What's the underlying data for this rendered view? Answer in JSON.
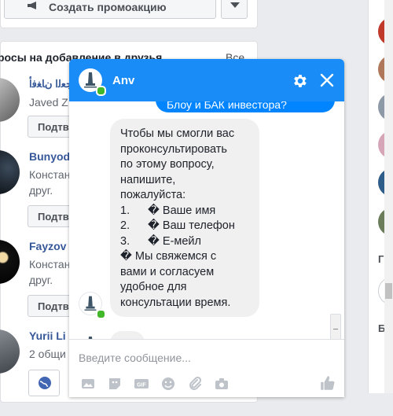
{
  "promo": {
    "button_label": "Создать промоакцию"
  },
  "friend_requests": {
    "title": "росы на добавление в друзья",
    "see_all": "Все",
    "rows": [
      {
        "name": "ﺕﻻﺎﺠﻌﻟﺍ ﻥﺎﻐﻓﺃ",
        "sub_lines": [
          "Javed Z"
        ],
        "confirm": "Подтв"
      },
      {
        "name": "Bunyod",
        "sub_lines": [
          "Констан",
          "друг."
        ],
        "confirm": "Подтв"
      },
      {
        "name": "Fayzov",
        "sub_lines": [
          "Констан",
          "друг."
        ],
        "confirm": "Подтв"
      },
      {
        "name": "Yurii Li",
        "sub_lines": [
          "2 общи"
        ],
        "confirm": ""
      }
    ]
  },
  "right_col": {
    "group_label": "ГРУ",
    "bottom_label": "БО"
  },
  "chat": {
    "title": "Anv",
    "outgoing_text": "Блоу и БАК инвестора?",
    "incoming": {
      "lines_top": [
        "Чтобы мы смогли вас",
        "проконсультировать",
        "по этому вопросу,",
        "напишите,",
        "пожалуйста:"
      ],
      "list": [
        {
          "n": "1.",
          "t": "� Ваше имя"
        },
        {
          "n": "2.",
          "t": "� Ваш телефон"
        },
        {
          "n": "3.",
          "t": "� Е-мейл"
        }
      ],
      "lines_bottom": [
        "� Мы свяжемся с",
        "вами и согласуем",
        "удобное для",
        "консультации время."
      ]
    },
    "composer_placeholder": "Введите сообщение...",
    "tools": [
      "photo-icon",
      "sticker-icon",
      "gif-icon",
      "emoji-icon",
      "attach-icon",
      "camera-icon",
      "like-icon"
    ]
  },
  "colors": {
    "accent": "#1a8cf8",
    "bubble_out": "#0084ff",
    "bubble_in": "#f1f0f0",
    "link": "#365899"
  }
}
